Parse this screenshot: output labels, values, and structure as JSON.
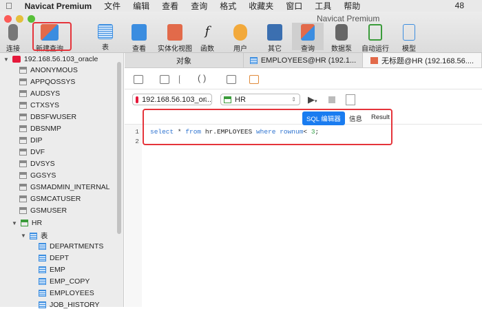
{
  "menubar": {
    "app": "Navicat Premium",
    "items": [
      "文件",
      "编辑",
      "查看",
      "查询",
      "格式",
      "收藏夹",
      "窗口",
      "工具",
      "帮助"
    ],
    "right": "48"
  },
  "window": {
    "title": "Navicat Premium"
  },
  "toolbar": [
    "连接",
    "新建查询",
    "表",
    "查看",
    "实体化视图",
    "函数",
    "用户",
    "其它",
    "查询",
    "数据泵",
    "自动运行",
    "模型"
  ],
  "sidebar": {
    "connection": "192.168.56.103_oracle",
    "schemas": [
      "ANONYMOUS",
      "APPQOSSYS",
      "AUDSYS",
      "CTXSYS",
      "DBSFWUSER",
      "DBSNMP",
      "DIP",
      "DVF",
      "DVSYS",
      "GGSYS",
      "GSMADMIN_INTERNAL",
      "GSMCATUSER",
      "GSMUSER"
    ],
    "hr": "HR",
    "tables_folder": "表",
    "tables": [
      "DEPARTMENTS",
      "DEPT",
      "EMP",
      "EMP_COPY",
      "EMPLOYEES",
      "JOB_HISTORY"
    ]
  },
  "tabs": [
    "对象",
    "EMPLOYEES@HR (192.1...",
    "无标题@HR (192.168.56...."
  ],
  "editor": {
    "connection": "192.168.56.103_or...",
    "schema": "HR",
    "seg": [
      "SQL 编辑器",
      "信息",
      "Result"
    ],
    "lines": [
      "1",
      "2"
    ],
    "code": {
      "k1": "select",
      "t1": " * ",
      "k2": "from",
      "t2": " hr.EMPLOYEES ",
      "k3": "where",
      "t3": " ",
      "k4": "rownum",
      "t4": "< ",
      "n": "3",
      "t5": ";"
    }
  },
  "colors": {
    "accent": "#1a7cf0",
    "highlight": "#e5333a"
  }
}
